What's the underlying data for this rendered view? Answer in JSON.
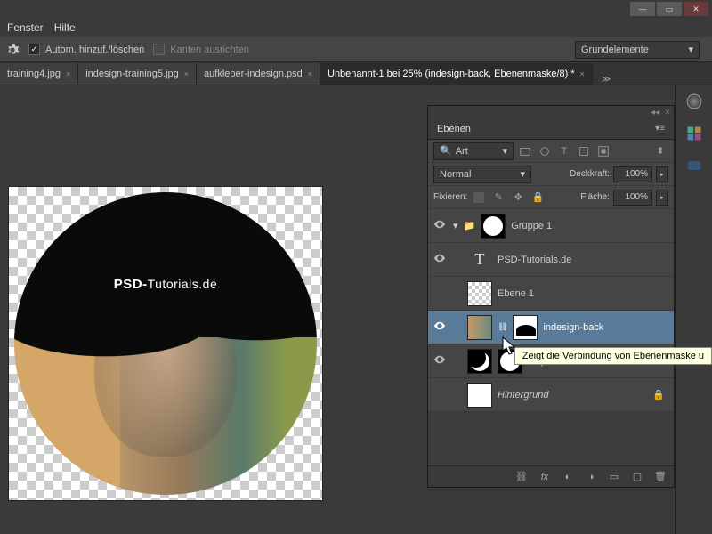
{
  "menu": {
    "fenster": "Fenster",
    "hilfe": "Hilfe"
  },
  "options": {
    "autoAdd": "Autom. hinzuf./löschen",
    "alignEdges": "Kanten ausrichten",
    "workspace": "Grundelemente"
  },
  "tabs": [
    {
      "label": "training4.jpg"
    },
    {
      "label": "indesign-training5.jpg"
    },
    {
      "label": "aufkleber-indesign.psd"
    },
    {
      "label": "Unbenannt-1 bei 25% (indesign-back, Ebenenmaske/8) *"
    }
  ],
  "canvas": {
    "text_bold": "PSD-",
    "text_thin": "Tutorials.de"
  },
  "panel": {
    "title": "Ebenen",
    "filterLabel": "Art",
    "blendMode": "Normal",
    "opacityLabel": "Deckkraft:",
    "opacityValue": "100%",
    "lockLabel": "Fixieren:",
    "fillLabel": "Fläche:",
    "fillValue": "100%"
  },
  "layers": {
    "group": "Gruppe 1",
    "text": "PSD-Tutorials.de",
    "ebene1": "Ebene 1",
    "indesign": "indesign-back",
    "ellipse": "Ellipse 1",
    "background": "Hintergrund"
  },
  "tooltip": "Zeigt die Verbindung von Ebenenmaske u"
}
